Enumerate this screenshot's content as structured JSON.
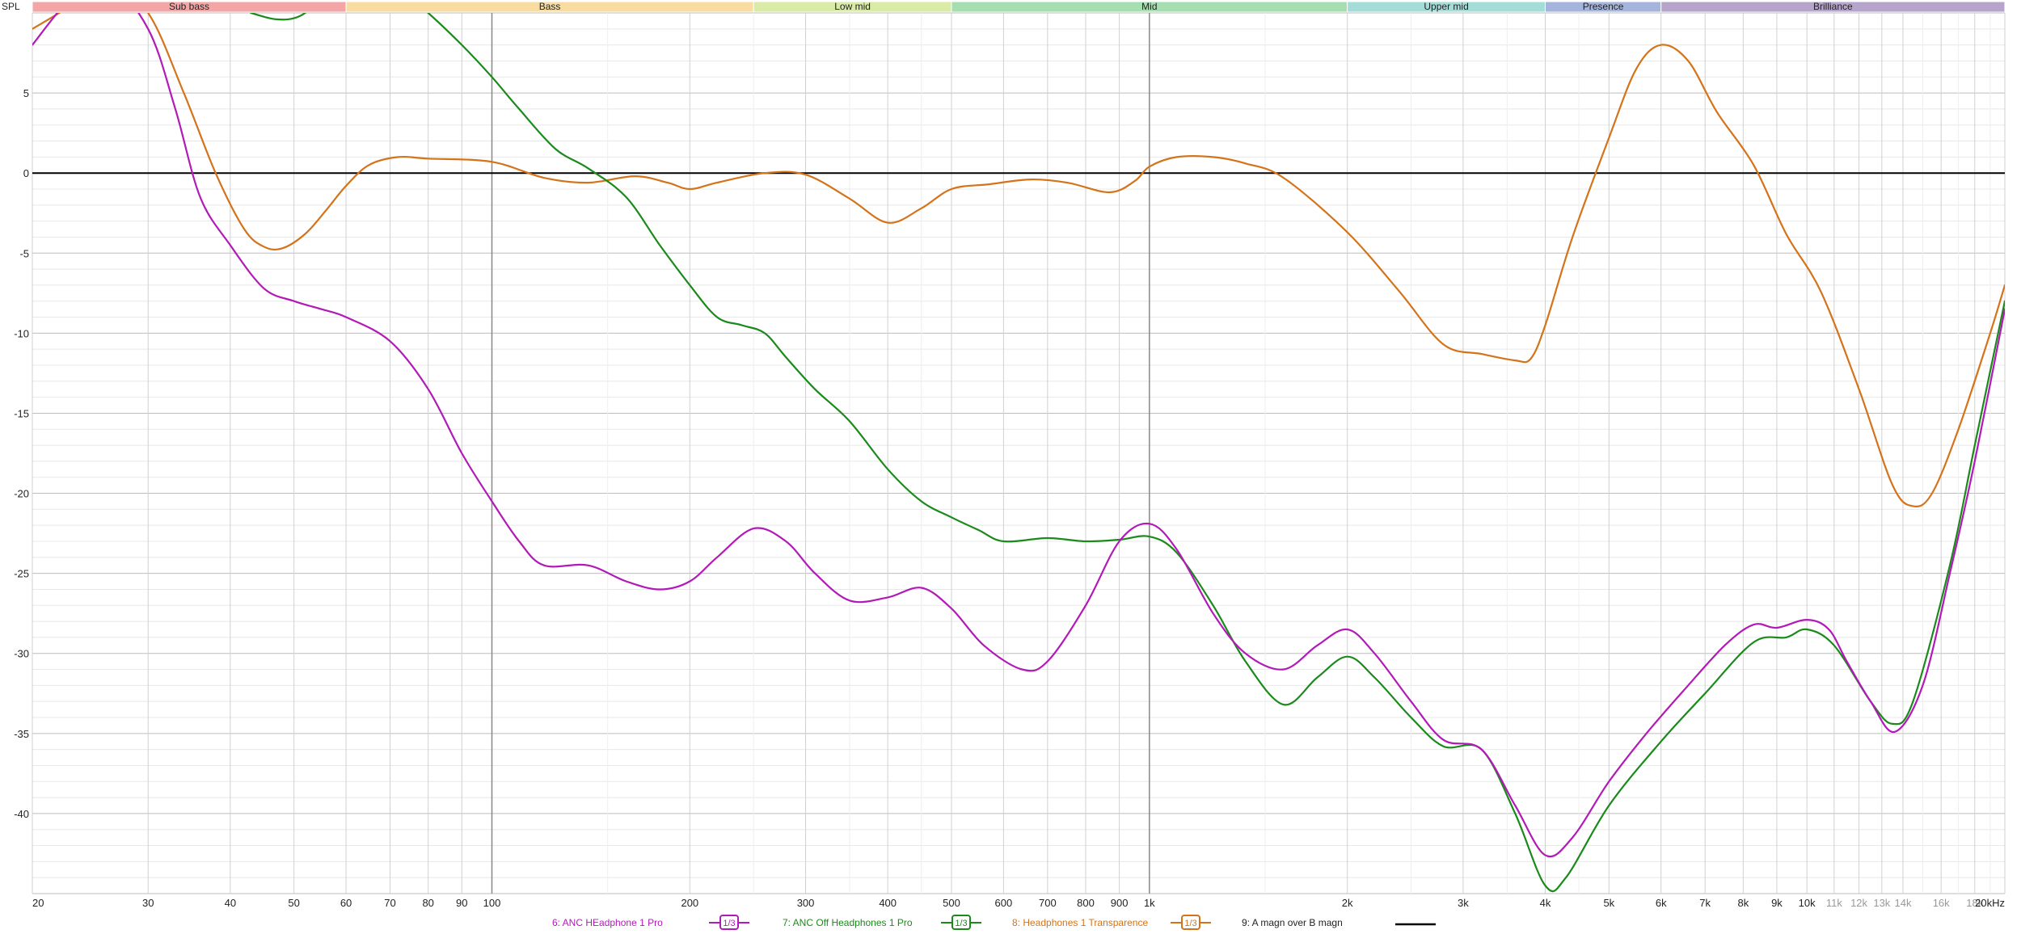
{
  "chart_data": {
    "type": "line",
    "ylabel": "SPL",
    "x_scale": "log",
    "xlim": [
      20,
      20000
    ],
    "ylim": [
      -45,
      10
    ],
    "grid": true,
    "legend_position": "bottom",
    "yticks": [
      "5",
      "0",
      "-5",
      "-10",
      "-15",
      "-20",
      "-25",
      "-30",
      "-35",
      "-40"
    ],
    "ytick_values": [
      5,
      0,
      -5,
      -10,
      -15,
      -20,
      -25,
      -30,
      -35,
      -40
    ],
    "xticks": [
      {
        "v": 20,
        "label": "20",
        "dim": false
      },
      {
        "v": 30,
        "label": "30",
        "dim": false
      },
      {
        "v": 40,
        "label": "40",
        "dim": false
      },
      {
        "v": 50,
        "label": "50",
        "dim": false
      },
      {
        "v": 60,
        "label": "60",
        "dim": false
      },
      {
        "v": 70,
        "label": "70",
        "dim": false
      },
      {
        "v": 80,
        "label": "80",
        "dim": false
      },
      {
        "v": 90,
        "label": "90",
        "dim": false
      },
      {
        "v": 100,
        "label": "100",
        "dim": false
      },
      {
        "v": 200,
        "label": "200",
        "dim": false
      },
      {
        "v": 300,
        "label": "300",
        "dim": false
      },
      {
        "v": 400,
        "label": "400",
        "dim": false
      },
      {
        "v": 500,
        "label": "500",
        "dim": false
      },
      {
        "v": 600,
        "label": "600",
        "dim": false
      },
      {
        "v": 700,
        "label": "700",
        "dim": false
      },
      {
        "v": 800,
        "label": "800",
        "dim": false
      },
      {
        "v": 900,
        "label": "900",
        "dim": false
      },
      {
        "v": 1000,
        "label": "1k",
        "dim": false
      },
      {
        "v": 2000,
        "label": "2k",
        "dim": false
      },
      {
        "v": 3000,
        "label": "3k",
        "dim": false
      },
      {
        "v": 4000,
        "label": "4k",
        "dim": false
      },
      {
        "v": 5000,
        "label": "5k",
        "dim": false
      },
      {
        "v": 6000,
        "label": "6k",
        "dim": false
      },
      {
        "v": 7000,
        "label": "7k",
        "dim": false
      },
      {
        "v": 8000,
        "label": "8k",
        "dim": false
      },
      {
        "v": 9000,
        "label": "9k",
        "dim": false
      },
      {
        "v": 10000,
        "label": "10k",
        "dim": false
      },
      {
        "v": 11000,
        "label": "11k",
        "dim": true
      },
      {
        "v": 12000,
        "label": "12k",
        "dim": true
      },
      {
        "v": 13000,
        "label": "13k",
        "dim": true
      },
      {
        "v": 14000,
        "label": "14k",
        "dim": true
      },
      {
        "v": 16000,
        "label": "16k",
        "dim": true
      },
      {
        "v": 18000,
        "label": "18k",
        "dim": true
      },
      {
        "v": 20000,
        "label": "20kHz",
        "dim": false
      }
    ],
    "bands": [
      {
        "label": "Sub bass",
        "from": 20,
        "to": 60,
        "color": "#f4a6a6"
      },
      {
        "label": "Bass",
        "from": 60,
        "to": 250,
        "color": "#f8dca0"
      },
      {
        "label": "Low mid",
        "from": 250,
        "to": 500,
        "color": "#d9eba4"
      },
      {
        "label": "Mid",
        "from": 500,
        "to": 2000,
        "color": "#a5deaf"
      },
      {
        "label": "Upper mid",
        "from": 2000,
        "to": 4000,
        "color": "#a4dcd8"
      },
      {
        "label": "Presence",
        "from": 4000,
        "to": 6000,
        "color": "#a4b4dc"
      },
      {
        "label": "Brilliance",
        "from": 6000,
        "to": 20000,
        "color": "#b6a4cc"
      }
    ],
    "series": [
      {
        "name": "6: ANC HEadphone 1 Pro",
        "color": "#b21ab8",
        "smoothing": "1/3",
        "points": [
          [
            20,
            8
          ],
          [
            23,
            11
          ],
          [
            26,
            12
          ],
          [
            30,
            9
          ],
          [
            33,
            4
          ],
          [
            36,
            -1.5
          ],
          [
            40,
            -4.5
          ],
          [
            45,
            -7.2
          ],
          [
            50,
            -8
          ],
          [
            55,
            -8.5
          ],
          [
            60,
            -9
          ],
          [
            70,
            -10.5
          ],
          [
            80,
            -13.5
          ],
          [
            90,
            -17.5
          ],
          [
            100,
            -20.5
          ],
          [
            110,
            -23
          ],
          [
            120,
            -24.5
          ],
          [
            140,
            -24.5
          ],
          [
            160,
            -25.5
          ],
          [
            180,
            -26
          ],
          [
            200,
            -25.5
          ],
          [
            220,
            -24
          ],
          [
            250,
            -22.2
          ],
          [
            280,
            -23
          ],
          [
            310,
            -25
          ],
          [
            350,
            -26.7
          ],
          [
            400,
            -26.5
          ],
          [
            450,
            -25.9
          ],
          [
            500,
            -27.2
          ],
          [
            560,
            -29.5
          ],
          [
            640,
            -31
          ],
          [
            700,
            -30.5
          ],
          [
            800,
            -27
          ],
          [
            900,
            -23
          ],
          [
            1000,
            -21.9
          ],
          [
            1100,
            -23.5
          ],
          [
            1250,
            -27.5
          ],
          [
            1400,
            -30
          ],
          [
            1600,
            -31
          ],
          [
            1800,
            -29.5
          ],
          [
            2000,
            -28.5
          ],
          [
            2200,
            -30
          ],
          [
            2500,
            -33
          ],
          [
            2800,
            -35.4
          ],
          [
            3200,
            -36
          ],
          [
            3600,
            -39.5
          ],
          [
            4000,
            -42.6
          ],
          [
            4400,
            -41.5
          ],
          [
            5000,
            -38
          ],
          [
            5700,
            -35
          ],
          [
            6500,
            -32.3
          ],
          [
            7500,
            -29.5
          ],
          [
            8300,
            -28.2
          ],
          [
            9000,
            -28.4
          ],
          [
            10000,
            -27.9
          ],
          [
            10800,
            -28.5
          ],
          [
            11500,
            -30.5
          ],
          [
            12500,
            -33
          ],
          [
            13600,
            -34.9
          ],
          [
            15000,
            -32
          ],
          [
            16500,
            -25
          ],
          [
            18000,
            -18
          ],
          [
            20000,
            -8.5
          ]
        ]
      },
      {
        "name": "7: ANC Off Headphones 1 Pro",
        "color": "#1a8a1a",
        "smoothing": "1/3",
        "points": [
          [
            43,
            10
          ],
          [
            47,
            9.6
          ],
          [
            51,
            9.8
          ],
          [
            56,
            11
          ],
          [
            62,
            12
          ],
          [
            70,
            12
          ],
          [
            80,
            10
          ],
          [
            90,
            8
          ],
          [
            100,
            6
          ],
          [
            110,
            4
          ],
          [
            125,
            1.5
          ],
          [
            140,
            0.3
          ],
          [
            160,
            -1.5
          ],
          [
            180,
            -4.5
          ],
          [
            200,
            -7
          ],
          [
            220,
            -9
          ],
          [
            240,
            -9.5
          ],
          [
            260,
            -10
          ],
          [
            280,
            -11.5
          ],
          [
            310,
            -13.5
          ],
          [
            350,
            -15.5
          ],
          [
            400,
            -18.5
          ],
          [
            450,
            -20.5
          ],
          [
            500,
            -21.5
          ],
          [
            550,
            -22.3
          ],
          [
            600,
            -23
          ],
          [
            700,
            -22.8
          ],
          [
            800,
            -23
          ],
          [
            900,
            -22.9
          ],
          [
            1000,
            -22.7
          ],
          [
            1100,
            -23.7
          ],
          [
            1250,
            -27
          ],
          [
            1400,
            -30.5
          ],
          [
            1600,
            -33.2
          ],
          [
            1800,
            -31.5
          ],
          [
            2000,
            -30.2
          ],
          [
            2200,
            -31.5
          ],
          [
            2500,
            -34
          ],
          [
            2800,
            -35.8
          ],
          [
            3200,
            -36
          ],
          [
            3600,
            -40
          ],
          [
            4000,
            -44.5
          ],
          [
            4300,
            -44
          ],
          [
            5000,
            -39.5
          ],
          [
            6000,
            -35.5
          ],
          [
            7000,
            -32.5
          ],
          [
            8300,
            -29.3
          ],
          [
            9300,
            -29
          ],
          [
            10000,
            -28.5
          ],
          [
            11000,
            -29.5
          ],
          [
            12500,
            -33
          ],
          [
            13500,
            -34.4
          ],
          [
            14500,
            -33
          ],
          [
            16500,
            -24.5
          ],
          [
            18000,
            -17
          ],
          [
            20000,
            -8
          ]
        ]
      },
      {
        "name": "8: Headphones 1 Transparence",
        "color": "#d4731a",
        "smoothing": "1/3",
        "points": [
          [
            20,
            9
          ],
          [
            23,
            10.5
          ],
          [
            26,
            12
          ],
          [
            30,
            10
          ],
          [
            34,
            5
          ],
          [
            38,
            0
          ],
          [
            42,
            -3.5
          ],
          [
            45,
            -4.6
          ],
          [
            48,
            -4.7
          ],
          [
            52,
            -3.8
          ],
          [
            56,
            -2.3
          ],
          [
            60,
            -0.8
          ],
          [
            65,
            0.5
          ],
          [
            72,
            1.0
          ],
          [
            80,
            0.9
          ],
          [
            100,
            0.7
          ],
          [
            120,
            -0.3
          ],
          [
            140,
            -0.6
          ],
          [
            165,
            -0.2
          ],
          [
            185,
            -0.6
          ],
          [
            200,
            -1.0
          ],
          [
            220,
            -0.6
          ],
          [
            260,
            0.0
          ],
          [
            300,
            -0.1
          ],
          [
            350,
            -1.6
          ],
          [
            400,
            -3.1
          ],
          [
            450,
            -2.2
          ],
          [
            500,
            -1.0
          ],
          [
            570,
            -0.7
          ],
          [
            660,
            -0.4
          ],
          [
            750,
            -0.6
          ],
          [
            870,
            -1.2
          ],
          [
            950,
            -0.5
          ],
          [
            1000,
            0.4
          ],
          [
            1100,
            1.0
          ],
          [
            1250,
            1.0
          ],
          [
            1400,
            0.6
          ],
          [
            1600,
            -0.3
          ],
          [
            2000,
            -3.7
          ],
          [
            2400,
            -7.4
          ],
          [
            2800,
            -10.7
          ],
          [
            3200,
            -11.3
          ],
          [
            3600,
            -11.7
          ],
          [
            3800,
            -11.6
          ],
          [
            4000,
            -9.5
          ],
          [
            4400,
            -4
          ],
          [
            5000,
            2.2
          ],
          [
            5500,
            6.5
          ],
          [
            6000,
            8
          ],
          [
            6600,
            7
          ],
          [
            7300,
            3.8
          ],
          [
            8300,
            0.5
          ],
          [
            9300,
            -3.8
          ],
          [
            10500,
            -7.4
          ],
          [
            12000,
            -13.5
          ],
          [
            13500,
            -19.5
          ],
          [
            14500,
            -20.8
          ],
          [
            15500,
            -20
          ],
          [
            17000,
            -16
          ],
          [
            19000,
            -10
          ],
          [
            20000,
            -7
          ]
        ]
      },
      {
        "name": "9: A magn over B magn",
        "color": "#000000",
        "smoothing": "",
        "points": [
          [
            20,
            0
          ],
          [
            20000,
            0
          ]
        ]
      }
    ]
  }
}
